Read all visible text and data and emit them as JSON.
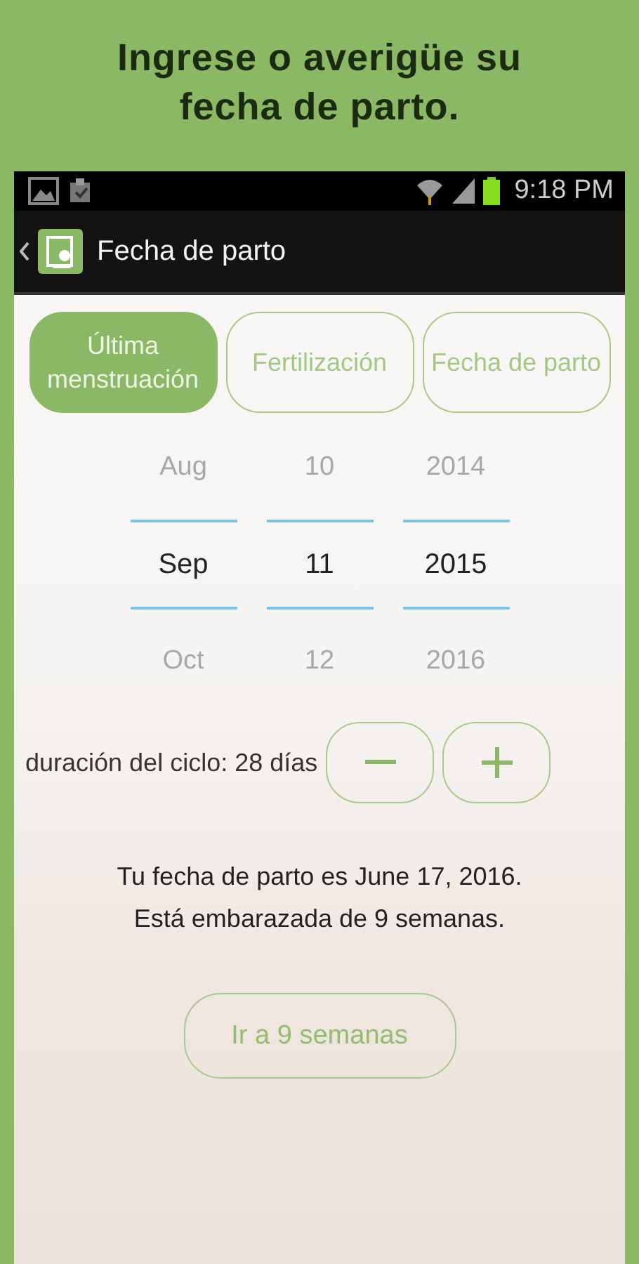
{
  "headline": "Ingrese o averigüe su fecha de parto.",
  "status_bar": {
    "time": "9:18 PM"
  },
  "action_bar": {
    "title": "Fecha de parto"
  },
  "tabs": [
    {
      "label": "Última menstruación",
      "selected": true
    },
    {
      "label": "Fertilización",
      "selected": false
    },
    {
      "label": "Fecha de parto",
      "selected": false
    }
  ],
  "date_picker": [
    {
      "previous": "Aug",
      "current": "Sep",
      "next": "Oct"
    },
    {
      "previous": "10",
      "current": "11",
      "next": "12"
    },
    {
      "previous": "2014",
      "current": "2015",
      "next": "2016"
    }
  ],
  "cycle": {
    "label": "duración del ciclo: 28 días"
  },
  "result": [
    "Tu fecha de parto es June 17, 2016.",
    "Está embarazada de 9 semanas."
  ],
  "go_button": "Ir a 9 semanas"
}
